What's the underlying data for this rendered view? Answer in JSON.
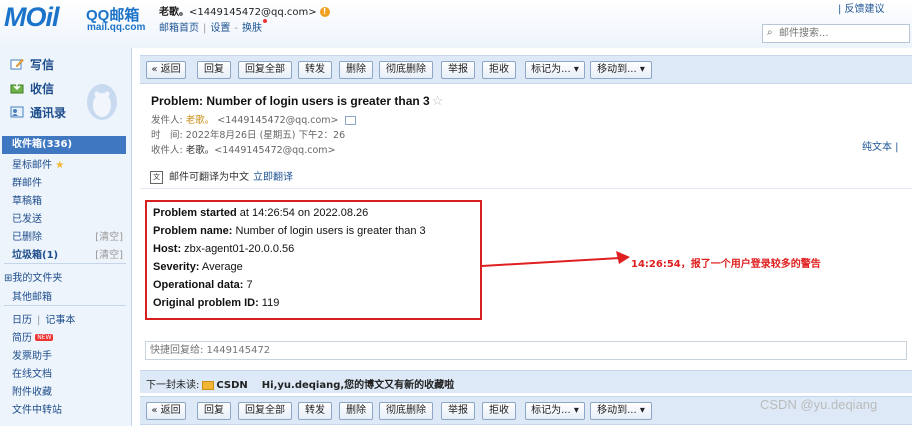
{
  "header": {
    "logo_main": "MOil",
    "logo_qq": "QQ邮箱",
    "logo_url": "mail.qq.com",
    "user_name": "老歌。",
    "user_email": "<1449145472@qq.com>",
    "links": [
      "邮箱首页",
      "设置",
      "换肤"
    ],
    "feedback": "| 反馈建议",
    "search_placeholder": "邮件搜索..."
  },
  "sidebar": {
    "compose": "写信",
    "receive": "收信",
    "contacts": "通讯录",
    "inbox": "收件箱(336)",
    "folders": [
      {
        "label": "星标邮件",
        "extra": ""
      },
      {
        "label": "群邮件",
        "extra": ""
      },
      {
        "label": "草稿箱",
        "extra": ""
      },
      {
        "label": "已发送",
        "extra": ""
      },
      {
        "label": "已删除",
        "extra": "[清空]"
      },
      {
        "label": "垃圾箱(1)",
        "extra": "[清空]"
      }
    ],
    "my_folders": "⊞我的文件夹",
    "other_mailbox": "其他邮箱",
    "calendar": "日历",
    "notebook": "记事本",
    "resume": "简历",
    "new_badge": "NEW",
    "tools": [
      "发票助手",
      "在线文档",
      "附件收藏",
      "文件中转站"
    ]
  },
  "toolbar": {
    "buttons": [
      "« 返回",
      "回复",
      "回复全部",
      "转发",
      "删除",
      "彻底删除",
      "举报",
      "拒收",
      "标记为... ▾",
      "移动到... ▾"
    ]
  },
  "email": {
    "subject": "Problem: Number of login users is greater than 3",
    "from_label": "发件人:",
    "from_name": "老歌。",
    "from_email": "<1449145472@qq.com>",
    "time_label": "时　间:",
    "time_value": "2022年8月26日 (星期五) 下午2：26",
    "to_label": "收件人:",
    "to_name": "老歌。",
    "to_email": "<1449145472@qq.com>",
    "plain_text": "纯文本 |",
    "translate_note": "邮件可翻译为中文",
    "translate_link": "立即翻译"
  },
  "alert": {
    "lines": [
      {
        "key": "Problem started",
        "value": " at 14:26:54 on 2022.08.26"
      },
      {
        "key": "Problem name:",
        "value": " Number of login users is greater than 3"
      },
      {
        "key": "Host:",
        "value": " zbx-agent01-20.0.0.56"
      },
      {
        "key": "Severity:",
        "value": " Average"
      },
      {
        "key": "Operational data:",
        "value": " 7"
      },
      {
        "key": "Original problem ID:",
        "value": " 119"
      }
    ]
  },
  "annotation": "14:26:54，报了一个用户登录较多的警告",
  "quick_reply_placeholder": "快捷回复给: 1449145472",
  "next": {
    "label": "下一封未读:",
    "source": "CSDN",
    "title": "Hi,yu.deqiang,您的博文又有新的收藏啦"
  },
  "watermark": "CSDN @yu.deqiang",
  "colors": {
    "accent": "#1b74c9",
    "annotation": "#e02020",
    "alert_border": "#d92020"
  }
}
